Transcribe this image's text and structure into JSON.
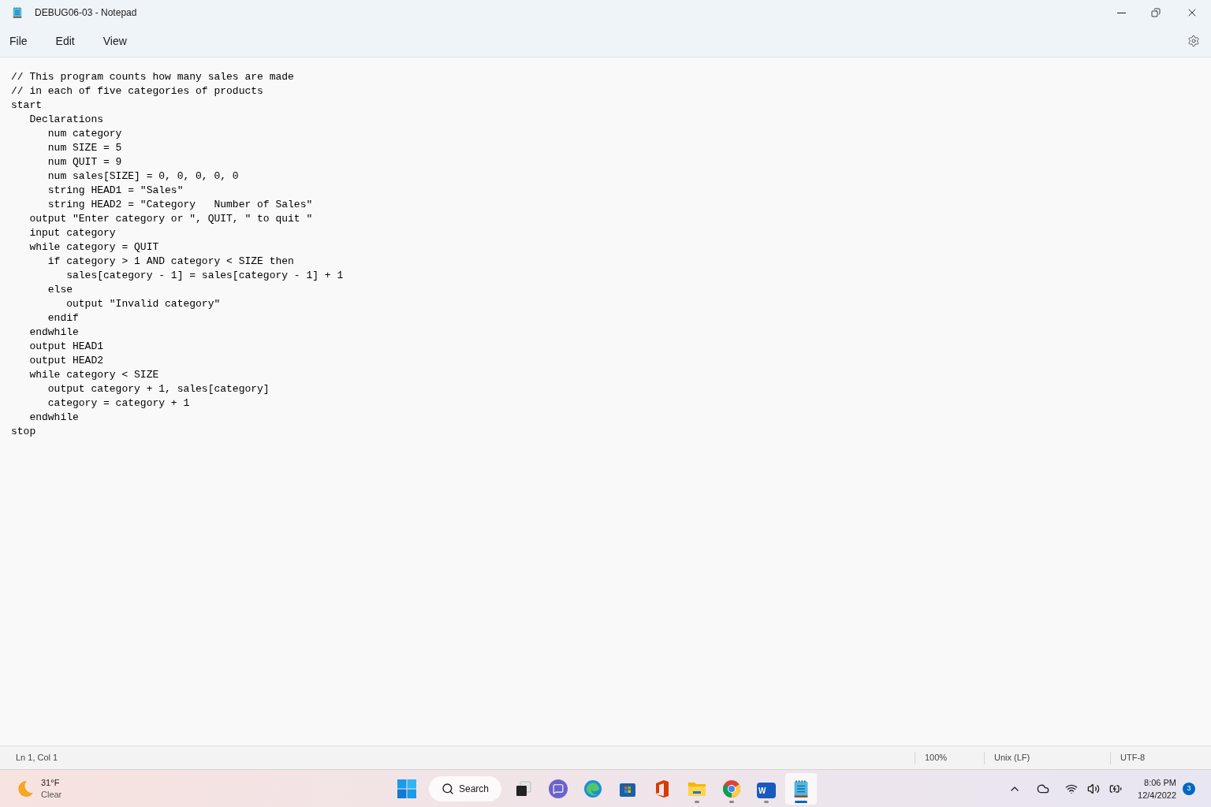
{
  "window": {
    "title": "DEBUG06-03 - Notepad"
  },
  "menu": [
    "File",
    "Edit",
    "View"
  ],
  "editor": {
    "lines": [
      "// This program counts how many sales are made",
      "// in each of five categories of products",
      "start",
      "   Declarations",
      "      num category",
      "      num SIZE = 5",
      "      num QUIT = 9",
      "      num sales[SIZE] = 0, 0, 0, 0, 0",
      "      string HEAD1 = \"Sales\"",
      "      string HEAD2 = \"Category   Number of Sales\"",
      "   output \"Enter category or \", QUIT, \" to quit \"",
      "   input category",
      "   while category = QUIT",
      "      if category > 1 AND category < SIZE then",
      "         sales[category - 1] = sales[category - 1] + 1",
      "      else",
      "         output \"Invalid category\"",
      "      endif",
      "   endwhile",
      "   output HEAD1",
      "   output HEAD2",
      "   while category < SIZE",
      "      output category + 1, sales[category]",
      "      category = category + 1",
      "   endwhile",
      "stop"
    ]
  },
  "status_bar": {
    "position": "Ln 1, Col 1",
    "zoom": "100%",
    "line_ending": "Unix (LF)",
    "encoding": "UTF-8"
  },
  "taskbar": {
    "weather": {
      "temperature": "31°F",
      "condition": "Clear"
    },
    "items": [
      {
        "kind": "start",
        "running": false,
        "selected": false
      },
      {
        "kind": "search",
        "label": "Search"
      },
      {
        "kind": "taskview",
        "running": false,
        "selected": false
      },
      {
        "kind": "chat",
        "running": false,
        "selected": false
      },
      {
        "kind": "edge",
        "running": false,
        "selected": false
      },
      {
        "kind": "store",
        "running": false,
        "selected": false
      },
      {
        "kind": "office",
        "running": false,
        "selected": false
      },
      {
        "kind": "explorer",
        "running": true,
        "selected": false
      },
      {
        "kind": "chrome",
        "running": true,
        "selected": false
      },
      {
        "kind": "word",
        "label": "W",
        "running": true,
        "selected": false
      },
      {
        "kind": "notepad",
        "running": true,
        "selected": true
      }
    ],
    "time": "8:06 PM",
    "date": "12/4/2022",
    "notifications": "3"
  }
}
